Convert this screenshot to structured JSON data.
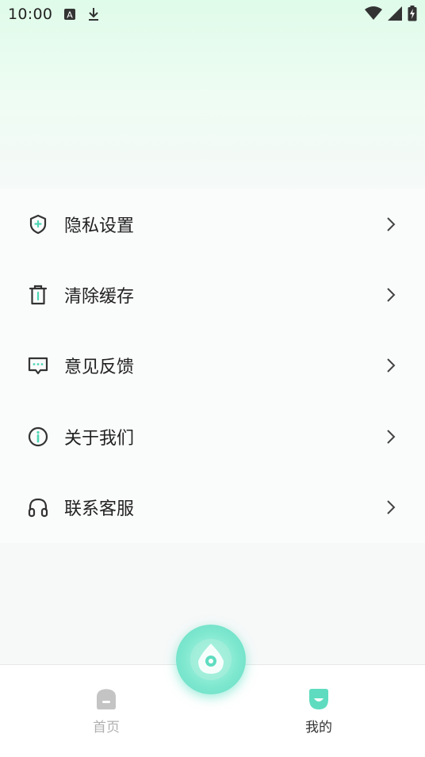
{
  "status_bar": {
    "time": "10:00",
    "notif_icons": [
      "text-a-icon",
      "download-icon"
    ],
    "right_icons": [
      "wifi-icon",
      "signal-icon",
      "battery-charging-icon"
    ]
  },
  "menu": {
    "items": [
      {
        "label": "隐私设置",
        "icon": "shield-icon"
      },
      {
        "label": "清除缓存",
        "icon": "trash-icon"
      },
      {
        "label": "意见反馈",
        "icon": "message-icon"
      },
      {
        "label": "关于我们",
        "icon": "info-icon"
      },
      {
        "label": "联系客服",
        "icon": "headphones-icon"
      }
    ]
  },
  "tabbar": {
    "home_label": "首页",
    "mine_label": "我的",
    "active_tab": "我的"
  },
  "colors": {
    "accent": "#5fdcc0",
    "header_gradient_top": "#dffbe9",
    "text": "#222222",
    "inactive": "#b0b0b0"
  }
}
